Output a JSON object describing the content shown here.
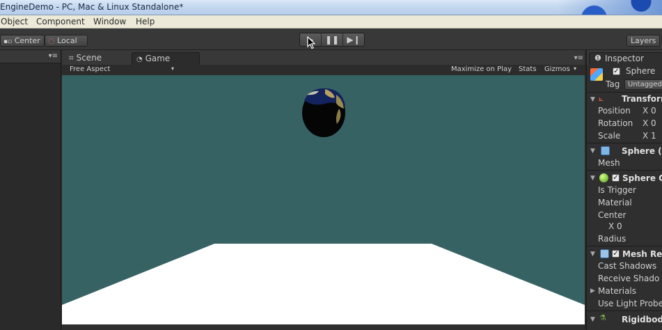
{
  "window": {
    "title": "EngineDemo - PC, Mac & Linux Standalone*"
  },
  "menu": {
    "items": [
      "Object",
      "Component",
      "Window",
      "Help"
    ]
  },
  "toolbar": {
    "pivot": "Center",
    "space": "Local",
    "layers": "Layers"
  },
  "tabs": {
    "scene": "Scene",
    "game": "Game"
  },
  "game_bar": {
    "aspect": "Free Aspect",
    "maximize": "Maximize on Play",
    "stats": "Stats",
    "gizmos": "Gizmos"
  },
  "inspector": {
    "tab": "Inspector",
    "object_name": "Sphere",
    "tag_label": "Tag",
    "tag_value": "Untagged",
    "transform": {
      "title": "Transform",
      "position": "Position",
      "rotation": "Rotation",
      "scale": "Scale",
      "pos_x": "X 0",
      "rot_x": "X 0",
      "scale_x": "X 1"
    },
    "mesh_filter": {
      "title": "Sphere (",
      "mesh_label": "Mesh"
    },
    "collider": {
      "title": "Sphere C",
      "is_trigger": "Is Trigger",
      "material": "Material",
      "center": "Center",
      "center_x": "X 0",
      "radius": "Radius"
    },
    "mesh_renderer": {
      "title": "Mesh Re",
      "cast_shadows": "Cast Shadows",
      "receive_shadows": "Receive Shado",
      "materials": "Materials",
      "use_light_probes": "Use Light Probe"
    },
    "rigidbody": {
      "title": "Rigidbod"
    }
  },
  "colors": {
    "sky": "#366263",
    "floor": "#ffffff",
    "panel": "#2f2f2f",
    "toolbar": "#383838"
  }
}
